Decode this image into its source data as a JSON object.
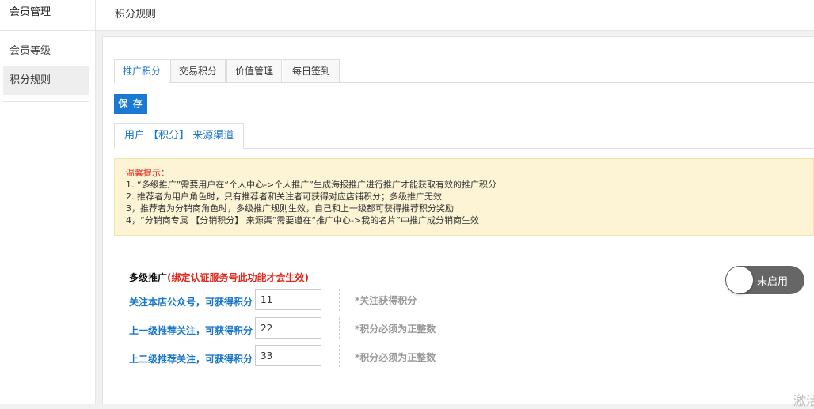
{
  "sidebar": {
    "title": "会员管理",
    "items": [
      {
        "label": "会员等级"
      },
      {
        "label": "积分规则"
      }
    ]
  },
  "header": {
    "breadcrumb": "积分规则"
  },
  "tabs": [
    {
      "label": "推广积分"
    },
    {
      "label": "交易积分"
    },
    {
      "label": "价值管理"
    },
    {
      "label": "每日签到"
    }
  ],
  "toolbar": {
    "save_label": "保 存"
  },
  "subtab": {
    "label": "用户 【积分】 来源渠道"
  },
  "notice": {
    "title": "温馨提示：",
    "lines": [
      "1. “多级推广”需要用户在“个人中心->个人推广”生成海报推广进行推广才能获取有效的推广积分",
      "2. 推荐者为用户角色时，只有推荐者和关注者可获得对应店铺积分；多级推广无效",
      "3，推荐者为分销商角色时，多级推广规则生效，自己和上一级都可获得推荐积分奖励",
      "4，“分销商专属 【分销积分】 来源渠”需要道在“推广中心->我的名片”中推广成分销商生效"
    ]
  },
  "multi_level": {
    "title": "多级推广",
    "warning": "(绑定认证服务号此功能才会生效)",
    "toggle_label": "未启用",
    "rows": [
      {
        "label": "关注本店公众号，可获得积分",
        "value": "11",
        "hint": "*关注获得积分"
      },
      {
        "label": "上一级推荐关注，可获得积分",
        "value": "22",
        "hint": "*积分必须为正整数"
      },
      {
        "label": "上二级推荐关注，可获得积分",
        "value": "33",
        "hint": "*积分必须为正整数"
      }
    ]
  },
  "watermark": "激活",
  "colors": {
    "accent": "#1a79d3",
    "warning": "#e0281e",
    "notice_bg": "#fcf4d4"
  }
}
